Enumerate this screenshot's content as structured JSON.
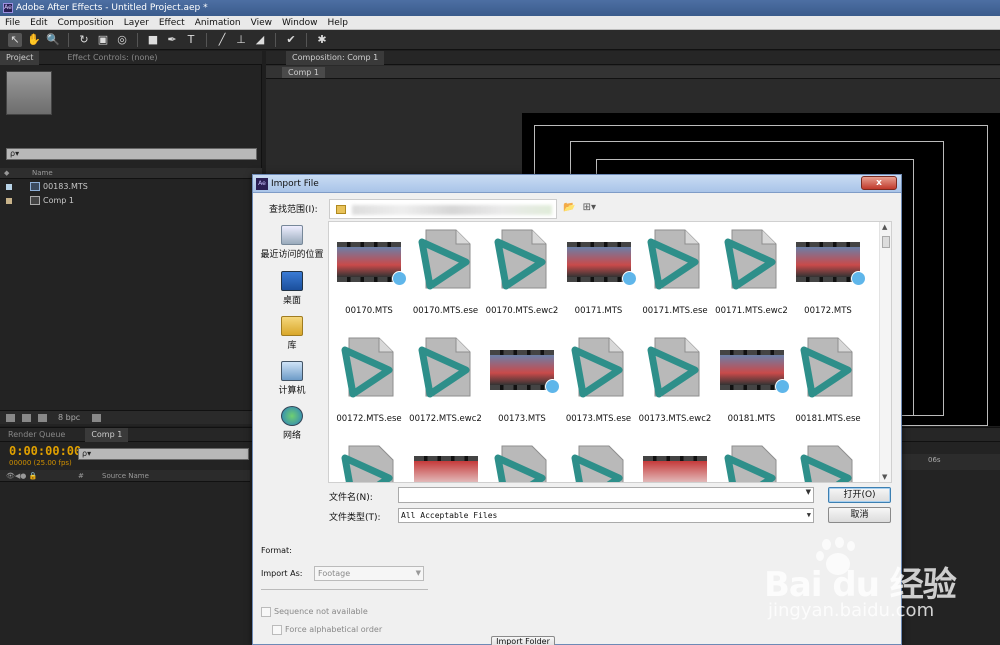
{
  "app": {
    "title": "Adobe After Effects - Untitled Project.aep *",
    "logo": "Ae"
  },
  "menu": [
    "File",
    "Edit",
    "Composition",
    "Layer",
    "Effect",
    "Animation",
    "View",
    "Window",
    "Help"
  ],
  "toolbar": {
    "tools": [
      "selection-tool",
      "hand-tool",
      "zoom-tool",
      "rotate-tool",
      "camera-tool",
      "pan-behind-tool",
      "rectangle-tool",
      "pen-tool",
      "text-tool",
      "brush-tool",
      "clone-stamp-tool",
      "eraser-tool",
      "roto-brush-tool",
      "puppet-pin-tool"
    ],
    "glyphs": [
      "↖",
      "✋",
      "🔍",
      "↻",
      "▣",
      "◎",
      "■",
      "✒",
      "T",
      "╱",
      "⊥",
      "◢",
      "✔",
      "✱"
    ]
  },
  "project_panel": {
    "tab_project": "Project",
    "tab_effects": "Effect Controls: (none)",
    "search_placeholder": "ρ▾",
    "col_name": "Name",
    "items": [
      {
        "name": "00183.MTS",
        "label_color": "#b8d4e8"
      },
      {
        "name": "Comp 1",
        "label_color": "#c8b38a"
      }
    ],
    "bpc": "8 bpc"
  },
  "composition_panel": {
    "tab": "Composition: Comp 1",
    "comp_chip": "Comp 1"
  },
  "timeline": {
    "tab_render": "Render Queue",
    "tab_comp": "Comp 1",
    "timecode": "0:00:00:00",
    "fps": "00000 (25.00 fps)",
    "search_placeholder": "ρ▾",
    "col_num": "#",
    "col_source": "Source Name",
    "ruler_mark": "06s"
  },
  "dialog": {
    "title": "Import File",
    "logo": "Ae",
    "close": "x",
    "look_in_label": "查找范围(I):",
    "places": [
      {
        "label": "最近访问的位置",
        "icon": "recent-places-icon"
      },
      {
        "label": "桌面",
        "icon": "desktop-icon"
      },
      {
        "label": "库",
        "icon": "libraries-icon"
      },
      {
        "label": "计算机",
        "icon": "computer-icon"
      },
      {
        "label": "网络",
        "icon": "network-icon"
      }
    ],
    "files_row1": [
      {
        "name": "00170.MTS",
        "type": "video"
      },
      {
        "name": "00170.MTS.ese",
        "type": "play"
      },
      {
        "name": "00170.MTS.ewc2",
        "type": "play"
      },
      {
        "name": "00171.MTS",
        "type": "video"
      },
      {
        "name": "00171.MTS.ese",
        "type": "play"
      },
      {
        "name": "00171.MTS.ewc2",
        "type": "play"
      },
      {
        "name": "00172.MTS",
        "type": "video"
      }
    ],
    "files_row2": [
      {
        "name": "00172.MTS.ese",
        "type": "play"
      },
      {
        "name": "00172.MTS.ewc2",
        "type": "play"
      },
      {
        "name": "00173.MTS",
        "type": "video"
      },
      {
        "name": "00173.MTS.ese",
        "type": "play"
      },
      {
        "name": "00173.MTS.ewc2",
        "type": "play"
      },
      {
        "name": "00181.MTS",
        "type": "video"
      },
      {
        "name": "00181.MTS.ese",
        "type": "play"
      }
    ],
    "file_name_label": "文件名(N):",
    "file_name_value": "",
    "file_type_label": "文件类型(T):",
    "file_type_value": "All Acceptable Files",
    "open_button": "打开(O)",
    "cancel_button": "取消",
    "format_label": "Format:",
    "import_as_label": "Import As:",
    "import_as_value": "Footage",
    "sequence_label": "Sequence not available",
    "force_alpha_label": "Force alphabetical order",
    "import_folder_button": "Import Folder"
  },
  "watermark": {
    "brand": "Bai du 经验",
    "url": "jingyan.baidu.com"
  }
}
